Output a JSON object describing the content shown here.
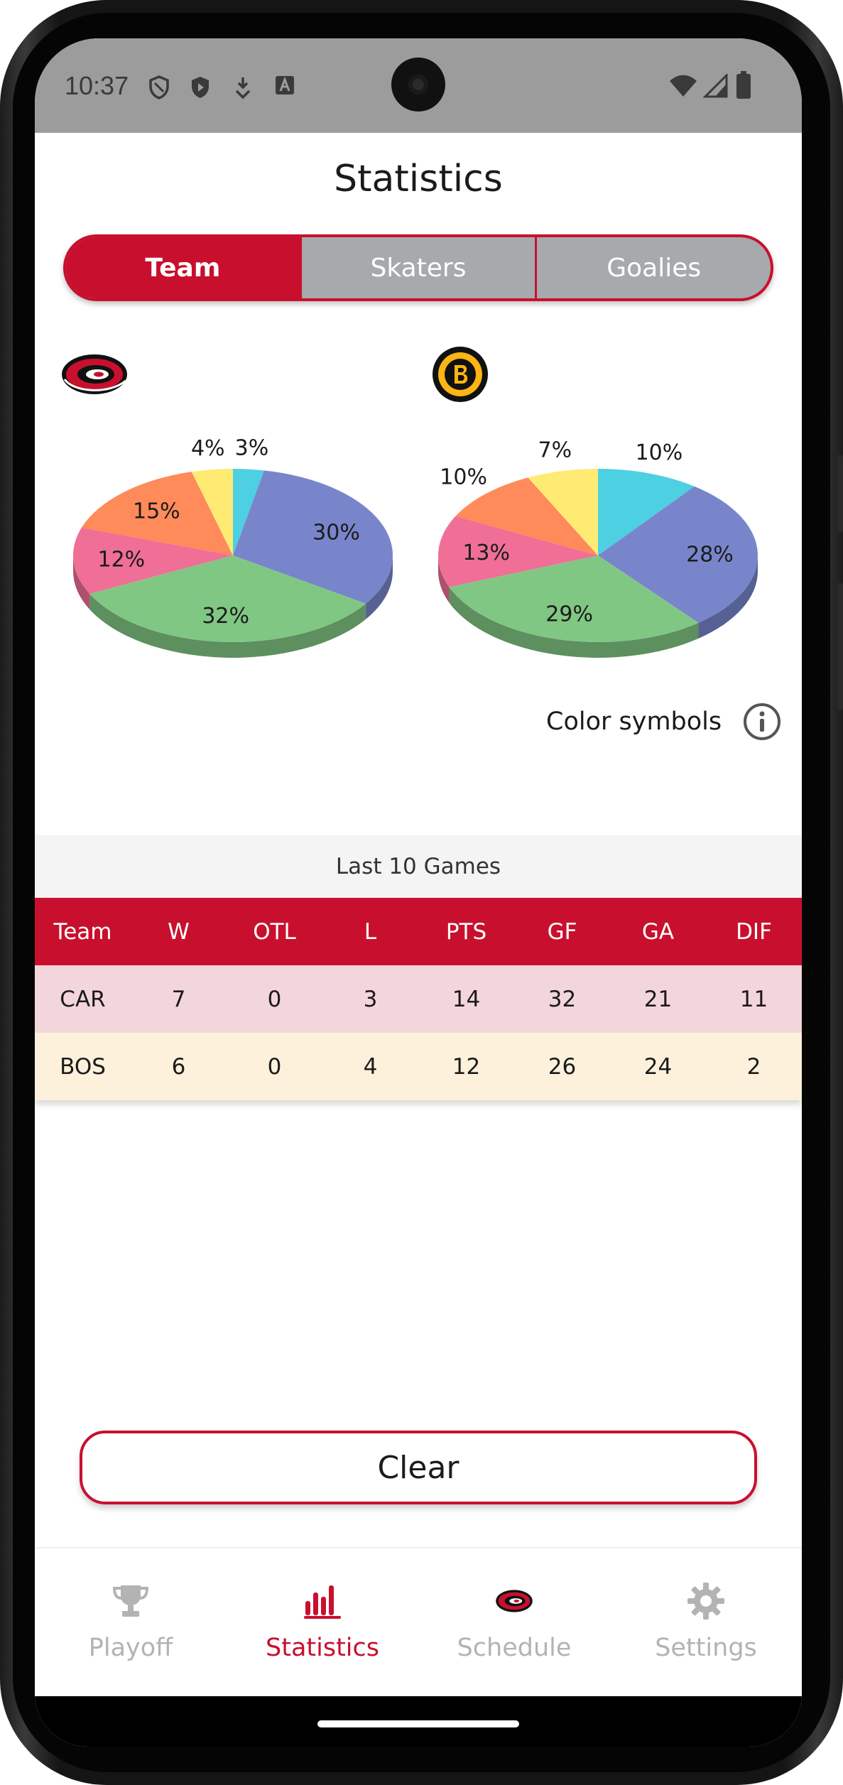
{
  "status_bar": {
    "time": "10:37",
    "left_icons": [
      "shield-outline-icon",
      "shield-play-icon",
      "download-icon",
      "text-a-icon"
    ],
    "right_icons": [
      "wifi-icon",
      "signal-icon",
      "battery-icon"
    ]
  },
  "page": {
    "title": "Statistics"
  },
  "segmented": {
    "tabs": [
      {
        "label": "Team",
        "active": true
      },
      {
        "label": "Skaters",
        "active": false
      },
      {
        "label": "Goalies",
        "active": false
      }
    ]
  },
  "colors": {
    "accent": "#c8102e",
    "tab_inactive": "#a7a9ac",
    "car_row": "#f3d6dc",
    "bos_row": "#fdf1dc",
    "slice_blue": "#7985cb",
    "slice_green": "#81c784",
    "slice_pink": "#ef6f96",
    "slice_orange": "#ff8a5a",
    "slice_yellow": "#ffeb74",
    "slice_cyan": "#4dd0e1"
  },
  "chart_data": [
    {
      "type": "pie",
      "team_logo": "hurricanes-logo",
      "slices": [
        {
          "label": "30%",
          "value": 30,
          "color": "#7985cb"
        },
        {
          "label": "32%",
          "value": 32,
          "color": "#81c784"
        },
        {
          "label": "12%",
          "value": 12,
          "color": "#ef6f96"
        },
        {
          "label": "15%",
          "value": 15,
          "color": "#ff8a5a"
        },
        {
          "label": "4%",
          "value": 4,
          "color": "#ffeb74"
        },
        {
          "label": "3%",
          "value": 3,
          "color": "#4dd0e1"
        }
      ]
    },
    {
      "type": "pie",
      "team_logo": "bruins-logo",
      "slices": [
        {
          "label": "28%",
          "value": 28,
          "color": "#7985cb"
        },
        {
          "label": "29%",
          "value": 29,
          "color": "#81c784"
        },
        {
          "label": "13%",
          "value": 13,
          "color": "#ef6f96"
        },
        {
          "label": "10%",
          "value": 10,
          "color": "#ff8a5a"
        },
        {
          "label": "7%",
          "value": 7,
          "color": "#ffeb74"
        },
        {
          "label": "10%",
          "value": 10,
          "color": "#4dd0e1"
        }
      ]
    }
  ],
  "legend_link": {
    "label": "Color symbols",
    "icon": "info-icon"
  },
  "table": {
    "caption": "Last 10 Games",
    "columns": [
      "Team",
      "W",
      "OTL",
      "L",
      "PTS",
      "GF",
      "GA",
      "DIF"
    ],
    "rows": [
      [
        "CAR",
        "7",
        "0",
        "3",
        "14",
        "32",
        "21",
        "11"
      ],
      [
        "BOS",
        "6",
        "0",
        "4",
        "12",
        "26",
        "24",
        "2"
      ]
    ]
  },
  "clear_button": {
    "label": "Clear"
  },
  "bottom_nav": {
    "items": [
      {
        "label": "Playoff",
        "icon": "trophy-icon",
        "active": false
      },
      {
        "label": "Statistics",
        "icon": "bar-chart-icon",
        "active": true
      },
      {
        "label": "Schedule",
        "icon": "hurricanes-logo-icon",
        "active": false
      },
      {
        "label": "Settings",
        "icon": "gear-icon",
        "active": false
      }
    ]
  }
}
